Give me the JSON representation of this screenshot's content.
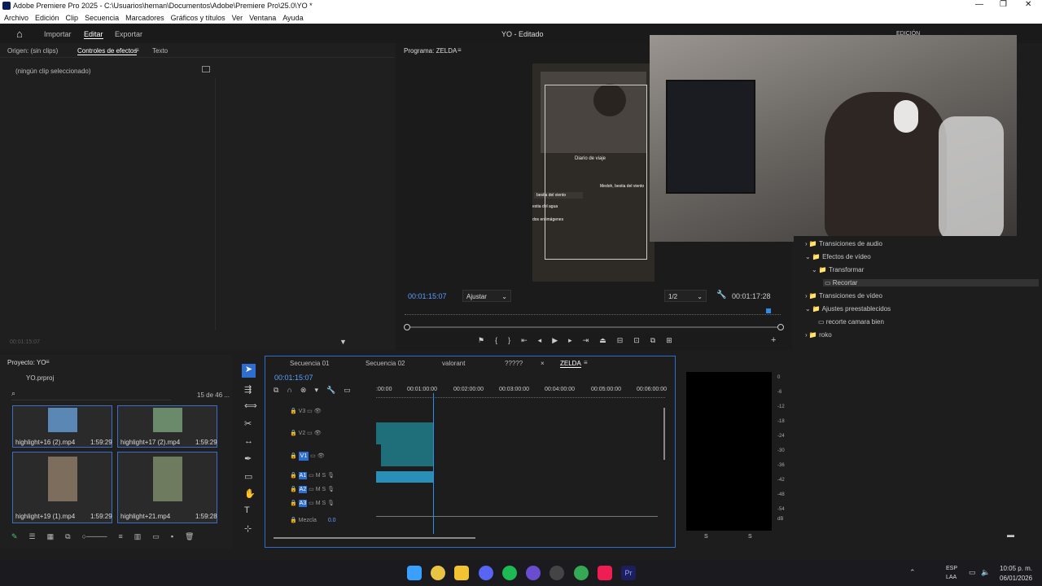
{
  "titlebar": {
    "title": "Adobe Premiere Pro 2025 - C:\\Usuarios\\heman\\Documentos\\Adobe\\Premiere Pro\\25.0\\YO *"
  },
  "menu": [
    "Archivo",
    "Edición",
    "Clip",
    "Secuencia",
    "Marcadores",
    "Gráficos y títulos",
    "Ver",
    "Ventana",
    "Ayuda"
  ],
  "nav": {
    "import": "Importar",
    "edit": "Editar",
    "export": "Exportar",
    "project_title": "YO - Editado",
    "workspace": "EDICIÓN"
  },
  "source": {
    "tabs": [
      "Origen: (sin clips)",
      "Controles de efectos",
      "Texto"
    ],
    "empty": "(ningún clip seleccionado)",
    "timecode": "00:01:15:07"
  },
  "program": {
    "title": "Programa: ZELDA",
    "timecode": "00:01:15:07",
    "fit": "Ajustar",
    "resolution": "1/2",
    "duration": "00:01:17:28"
  },
  "overlay": {
    "journal_title": "Diario de viaje",
    "items": [
      "bestia del viento",
      "estia del agua",
      "dos en imágenes"
    ],
    "right_title": "Medoh, bestia del viento"
  },
  "effects": {
    "items": [
      "Transiciones de audio",
      "Efectos de vídeo",
      "Transformar",
      "Recortar",
      "Transiciones de vídeo",
      "Ajustes preestablecidos",
      "recorte camara bien",
      "roko"
    ]
  },
  "project": {
    "title": "Proyecto: YO",
    "file": "YO.prproj",
    "count": "15 de 46 ...",
    "clips": [
      {
        "name": "highlight+16 (2).mp4",
        "dur": "1:59:29"
      },
      {
        "name": "highlight+17 (2).mp4",
        "dur": "1:59:29"
      },
      {
        "name": "highlight+19 (1).mp4",
        "dur": "1:59:29"
      },
      {
        "name": "highlight+21.mp4",
        "dur": "1:59:28"
      }
    ]
  },
  "timeline": {
    "tabs": [
      "Secuencia 01",
      "Secuencia 02",
      "valorant",
      "?????",
      "ZELDA"
    ],
    "timecode": "00:01:15:07",
    "ruler": [
      ":00:00",
      "00:01:00:00",
      "00:02:00:00",
      "00:03:00:00",
      "00:04:00:00",
      "00:05:00:00",
      "00:06:00:00"
    ],
    "tracks": [
      "V3",
      "V2",
      "V1",
      "A1",
      "A2",
      "A3"
    ],
    "mix_label": "Mezcla",
    "mix_value": "0.0"
  },
  "meter": {
    "scale": [
      "0",
      "-6",
      "-12",
      "-18",
      "-24",
      "-30",
      "-36",
      "-42",
      "-48",
      "-54",
      "dB"
    ],
    "bottom": [
      "S",
      "S"
    ]
  },
  "taskbar": {
    "lang1": "ESP",
    "lang2": "LAA",
    "time": "10:05 p. m.",
    "date": "06/01/2026"
  },
  "colors": {
    "accent": "#2d8ceb",
    "timecode": "#5aa0ff"
  }
}
